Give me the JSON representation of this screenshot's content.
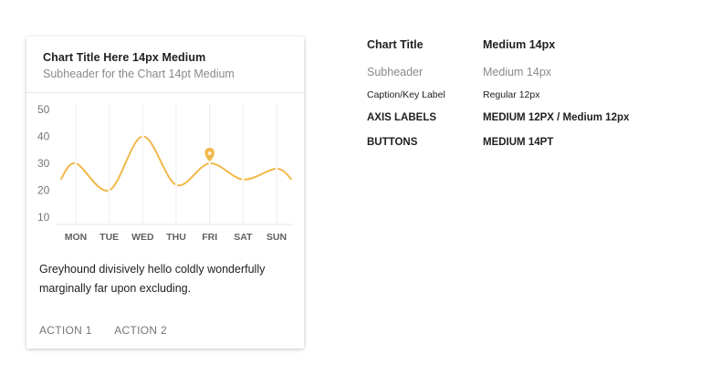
{
  "card": {
    "title": "Chart Title Here 14px Medium",
    "subtitle": "Subheader for the Chart 14pt Medium",
    "body": "Greyhound divisively hello coldly wonderfully marginally far upon excluding.",
    "actions": [
      "ACTION 1",
      "ACTION 2"
    ]
  },
  "chart_data": {
    "type": "line",
    "categories": [
      "MON",
      "TUE",
      "WED",
      "THU",
      "FRI",
      "SAT",
      "SUN"
    ],
    "y_ticks": [
      50,
      40,
      30,
      20,
      10
    ],
    "ylim": [
      10,
      50
    ],
    "series": [
      {
        "values": [
          30,
          20,
          40,
          22,
          30,
          24,
          28
        ]
      }
    ],
    "highlight": {
      "category": "FRI",
      "value": 30
    },
    "color": "#f0b94a",
    "grid": "vertical"
  },
  "spec": {
    "rows": [
      {
        "key": "Chart Title",
        "value": "Medium 14px"
      },
      {
        "key": "Subheader",
        "value": "Medium 14px"
      },
      {
        "key": "Caption/Key Label",
        "value": "Regular 12px"
      },
      {
        "key": "AXIS LABELS",
        "value": "MEDIUM 12PX / Medium 12px"
      },
      {
        "key": "BUTTONS",
        "value": "MEDIUM 14PT"
      }
    ]
  }
}
